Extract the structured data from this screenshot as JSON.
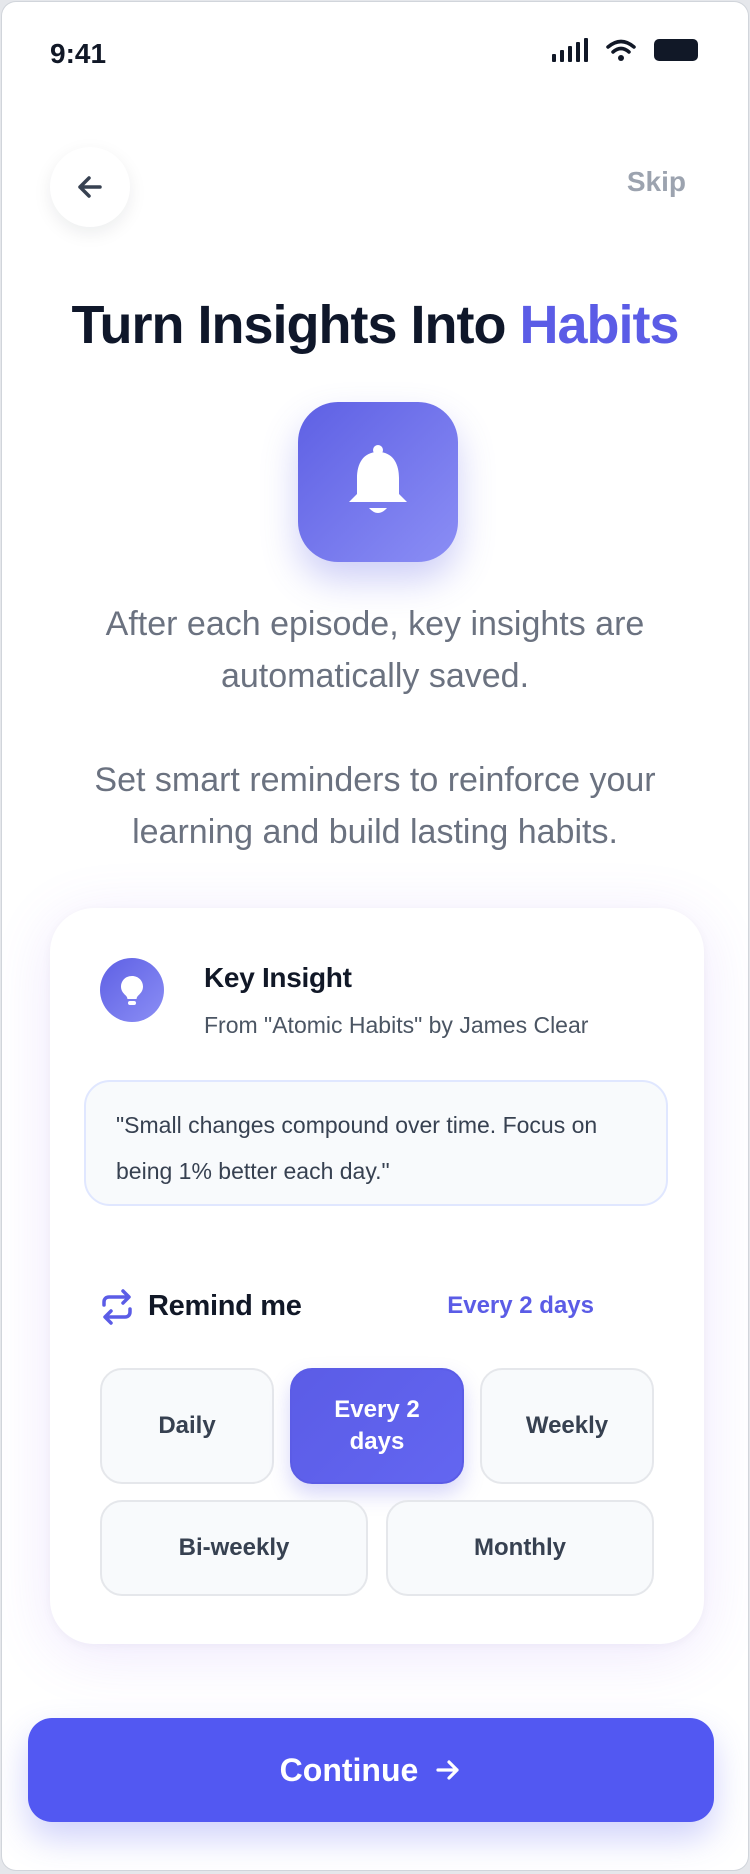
{
  "status_bar": {
    "time": "9:41"
  },
  "nav": {
    "skip_label": "Skip"
  },
  "hero": {
    "title_main": "Turn Insights Into",
    "title_accent": "Habits",
    "description_1": "After each episode, key insights are automatically saved.",
    "description_2": "Set smart reminders to reinforce your learning and build lasting habits."
  },
  "card": {
    "insight_title": "Key Insight",
    "insight_source": "From \"Atomic Habits\" by James Clear",
    "quote": "\"Small changes compound over time. Focus on being 1% better each day.\"",
    "remind_label": "Remind me",
    "remind_value": "Every 2 days",
    "options": [
      {
        "label": "Daily",
        "selected": false
      },
      {
        "label": "Every 2 days",
        "selected": true
      },
      {
        "label": "Weekly",
        "selected": false
      },
      {
        "label": "Bi-weekly",
        "selected": false
      },
      {
        "label": "Monthly",
        "selected": false
      }
    ]
  },
  "footer": {
    "continue_label": "Continue"
  },
  "colors": {
    "accent": "#5b5ce6",
    "primary_button": "#5258f2",
    "title_text": "#0f172a",
    "muted_text": "#6b7280"
  },
  "icons": {
    "back": "arrow-left-icon",
    "bell": "bell-icon",
    "insight": "lightbulb-icon",
    "remind": "repeat-icon",
    "continue": "arrow-right-icon"
  }
}
